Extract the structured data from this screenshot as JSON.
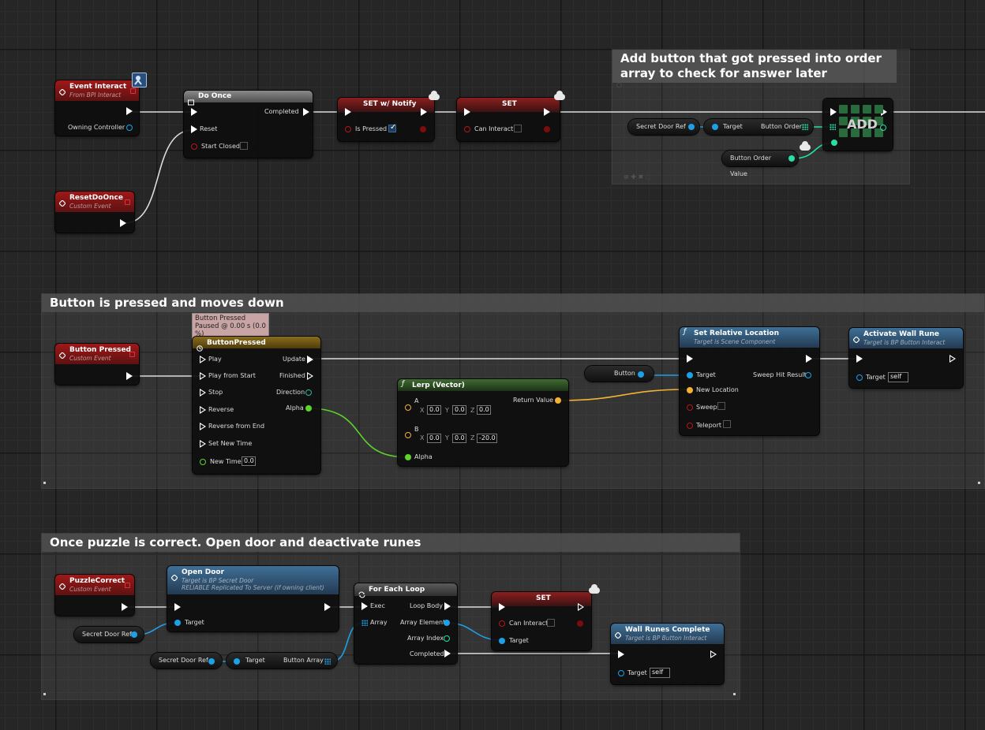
{
  "comments": {
    "add_to_order_array": "Add button that got pressed into order array to check for answer later",
    "button_pressed": "Button is pressed and moves down",
    "puzzle_correct": "Once puzzle is correct. Open door and deactivate runes"
  },
  "nodes": {
    "event_interact": {
      "title": "Event Interact",
      "subtitle": "From BPI Interact",
      "pin_owning_controller": "Owning Controller"
    },
    "reset_do_once": {
      "title": "ResetDoOnce",
      "subtitle": "Custom Event"
    },
    "do_once": {
      "title": "Do Once",
      "pin_completed": "Completed",
      "pin_reset": "Reset",
      "pin_start_closed": "Start Closed"
    },
    "set_notify": {
      "title": "SET w/ Notify",
      "pin_is_pressed": "Is Pressed",
      "is_pressed_checked": true
    },
    "set_can_interact": {
      "title": "SET",
      "pin_can_interact": "Can Interact",
      "can_interact_checked": false
    },
    "secret_door_ref_1": "Secret Door Ref",
    "add_node": {
      "label": "ADD",
      "pin_target": "Target",
      "pin_button_order": "Button Order"
    },
    "button_order_value": "Button Order Value",
    "button_pressed_event": {
      "title": "Button Pressed",
      "subtitle": "Custom Event"
    },
    "timeline_tooltip": {
      "line1": "Button Pressed",
      "line2": "Paused @ 0.00 s (0.0 %)"
    },
    "timeline": {
      "title": "ButtonPressed",
      "pins_in": [
        "Play",
        "Play from Start",
        "Stop",
        "Reverse",
        "Reverse from End",
        "Set New Time",
        "New Time"
      ],
      "pins_out": [
        "Update",
        "Finished",
        "Direction",
        "Alpha"
      ],
      "new_time_value": "0.0"
    },
    "lerp": {
      "title": "Lerp (Vector)",
      "pin_a": "A",
      "pin_b": "B",
      "pin_alpha": "Alpha",
      "pin_return": "Return Value",
      "axis_x": "X",
      "axis_y": "Y",
      "axis_z": "Z",
      "a_x": "0.0",
      "a_y": "0.0",
      "a_z": "0.0",
      "b_x": "0.0",
      "b_y": "0.0",
      "b_z": "-20.0"
    },
    "button_var": "Button",
    "set_relative_location": {
      "title": "Set Relative Location",
      "subtitle": "Target is Scene Component",
      "pin_target": "Target",
      "pin_new_location": "New Location",
      "pin_sweep": "Sweep",
      "pin_teleport": "Teleport",
      "pin_sweep_hit_result": "Sweep Hit Result"
    },
    "activate_wall_rune": {
      "title": "Activate Wall Rune",
      "subtitle": "Target is BP Button Interact",
      "pin_target": "Target",
      "target_value": "self"
    },
    "puzzle_correct_event": {
      "title": "PuzzleCorrect",
      "subtitle": "Custom Event"
    },
    "open_door": {
      "title": "Open Door",
      "subtitle1": "Target is BP Secret Door",
      "subtitle2": "RELIABLE Replicated To Server (if owning client)",
      "pin_target": "Target"
    },
    "secret_door_ref_2": "Secret Door Ref",
    "secret_door_ref_3": "Secret Door Ref",
    "get_button_array": {
      "pin_target": "Target",
      "pin_button_array": "Button Array"
    },
    "for_each_loop": {
      "title": "For Each Loop",
      "pin_exec": "Exec",
      "pin_array": "Array",
      "pin_loop_body": "Loop Body",
      "pin_array_element": "Array Element",
      "pin_array_index": "Array Index",
      "pin_completed": "Completed"
    },
    "set_can_interact_2": {
      "title": "SET",
      "pin_can_interact": "Can Interact",
      "pin_target": "Target"
    },
    "wall_runes_complete": {
      "title": "Wall Runes Complete",
      "subtitle": "Target is BP Button Interact",
      "pin_target": "Target",
      "target_value": "self"
    }
  },
  "colors": {
    "exec": "#ffffff",
    "object_pin": "#1ea0e6",
    "float_pin": "#5ed32a",
    "vector_pin": "#f2b234",
    "bool_pin": "#8b0e0e",
    "int_pin": "#26e0a8"
  }
}
